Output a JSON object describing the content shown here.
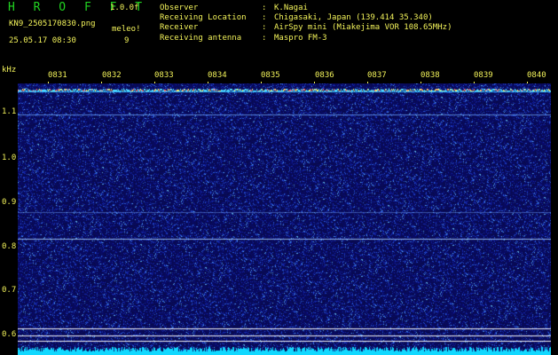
{
  "header": {
    "app_title": "H R O F F T",
    "version": "1.0.0f",
    "filename": "KN9_2505170830.png",
    "meleo_label": "meleo!",
    "datetime": "25.05.17 08:30",
    "meleo_count": "9"
  },
  "info": [
    {
      "label": "Observer",
      "sep": ":",
      "value": "K.Nagai"
    },
    {
      "label": "Receiving Location",
      "sep": ":",
      "value": "Chigasaki, Japan (139.414 35.340)"
    },
    {
      "label": "Receiver",
      "sep": ":",
      "value": "AirSpy mini (Miakejima VOR 108.65MHz)"
    },
    {
      "label": "Receiving antenna",
      "sep": ":",
      "value": "Maspro FM-3"
    }
  ],
  "axis": {
    "unit": "kHz",
    "y_ticks": [
      "1.1",
      "1.0",
      "0.9",
      "0.8",
      "0.7",
      "0.6"
    ],
    "x_ticks": [
      "0831",
      "0832",
      "0833",
      "0834",
      "0835",
      "0836",
      "0837",
      "0838",
      "0839",
      "0840"
    ]
  },
  "colors": {
    "background": "#000000",
    "label": "#f2f25a",
    "title": "#21d321",
    "noise_base": "#0a0f6e"
  }
}
